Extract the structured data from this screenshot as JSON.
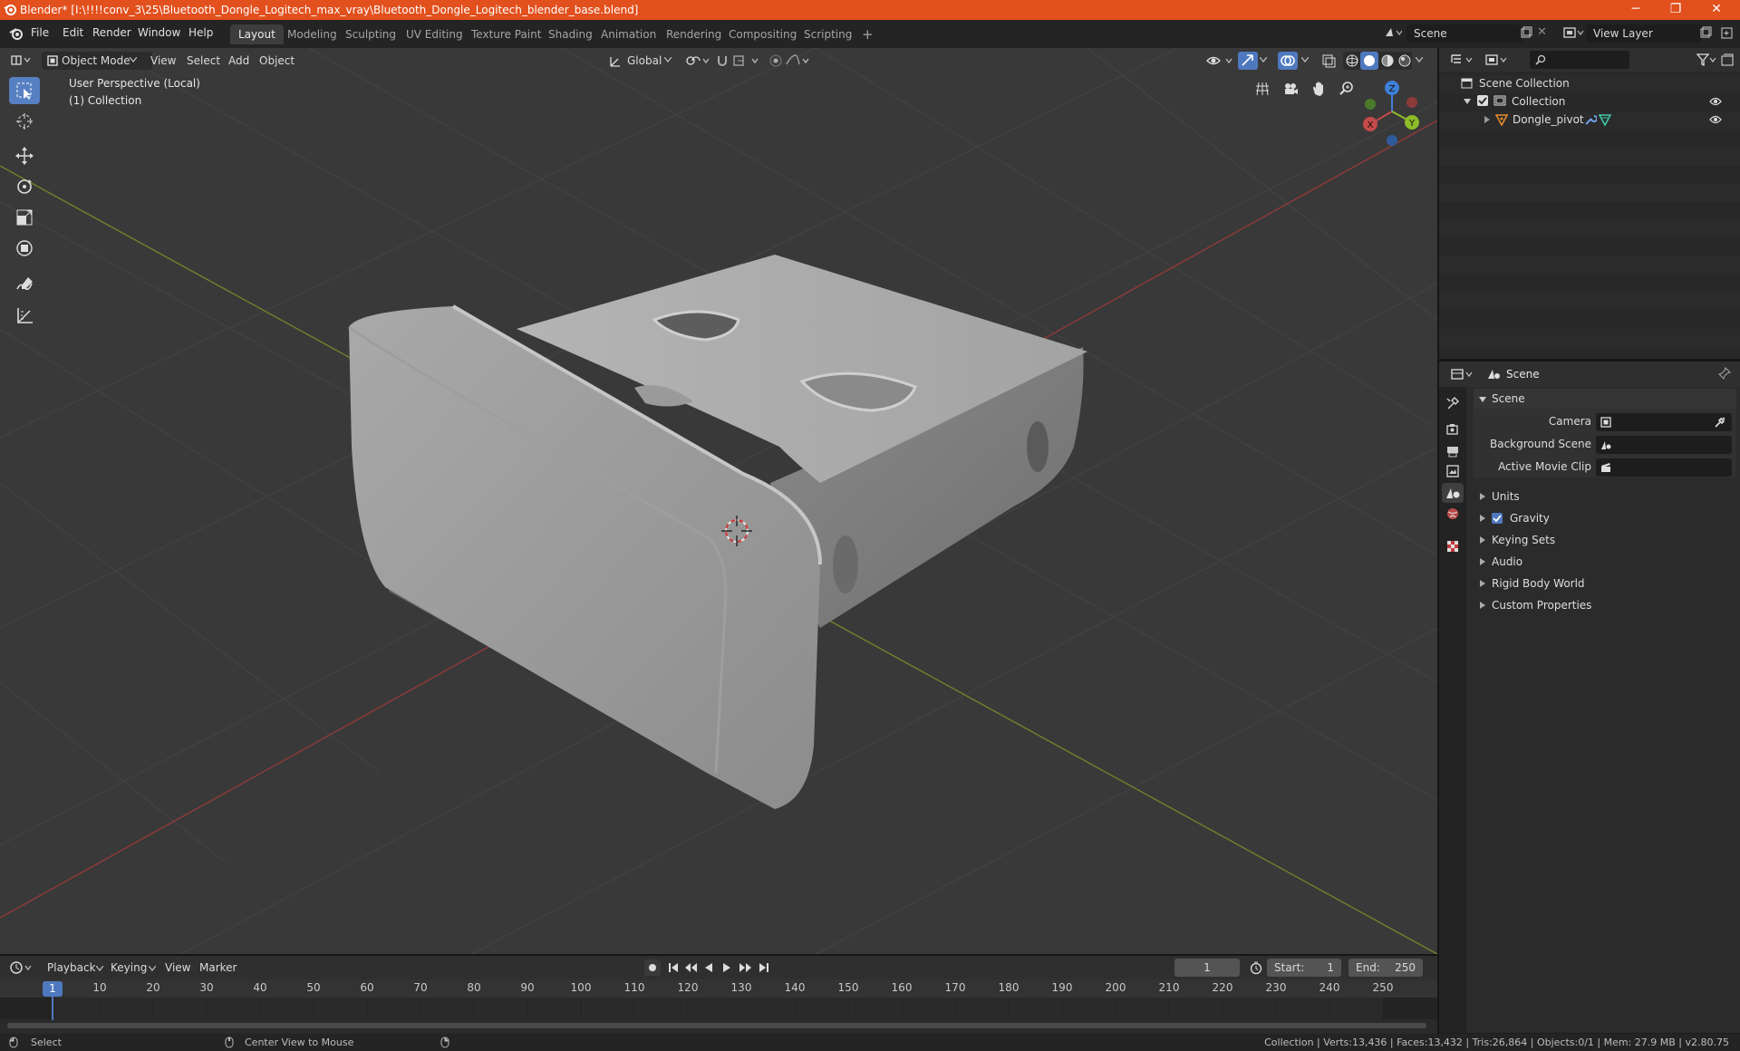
{
  "window": {
    "title": "Blender* [I:\\!!!!conv_3\\25\\Bluetooth_Dongle_Logitech_max_vray\\Bluetooth_Dongle_Logitech_blender_base.blend]",
    "minimize": "─",
    "maximize": "❐",
    "close": "✕"
  },
  "menubar": {
    "items": [
      "File",
      "Edit",
      "Render",
      "Window",
      "Help"
    ],
    "workspaces": [
      "Layout",
      "Modeling",
      "Sculpting",
      "UV Editing",
      "Texture Paint",
      "Shading",
      "Animation",
      "Rendering",
      "Compositing",
      "Scripting"
    ],
    "active_workspace": "Layout",
    "add_tab": "+",
    "scene_name": "Scene",
    "view_layer": "View Layer"
  },
  "viewport": {
    "mode": "Object Mode",
    "menus": [
      "View",
      "Select",
      "Add",
      "Object"
    ],
    "transform_orientation": "Global",
    "overlay_line1": "User Perspective (Local)",
    "overlay_line2": "(1) Collection",
    "gizmo": {
      "x": "X",
      "y": "Y",
      "z": "Z"
    }
  },
  "outliner": {
    "search_placeholder": "",
    "root": "Scene Collection",
    "collection": "Collection",
    "object": "Dongle_pivot"
  },
  "properties": {
    "header": "Scene",
    "panel": "Scene",
    "camera_label": "Camera",
    "background_label": "Background Scene",
    "clip_label": "Active Movie Clip",
    "sections": [
      "Units",
      "Gravity",
      "Keying Sets",
      "Audio",
      "Rigid Body World",
      "Custom Properties"
    ],
    "gravity_checked": true
  },
  "timeline": {
    "menus": [
      "Playback",
      "Keying",
      "View",
      "Marker"
    ],
    "current_frame": "1",
    "start_label": "Start:",
    "start_value": "1",
    "end_label": "End:",
    "end_value": "250",
    "ruler_current": "1",
    "ruler_ticks": [
      "10",
      "20",
      "30",
      "40",
      "50",
      "60",
      "70",
      "80",
      "90",
      "100",
      "110",
      "120",
      "130",
      "140",
      "150",
      "160",
      "170",
      "180",
      "190",
      "200",
      "210",
      "220",
      "230",
      "240",
      "250"
    ]
  },
  "statusbar": {
    "select": "Select",
    "center": "Center View to Mouse",
    "stats": "Collection | Verts:13,436 | Faces:13,432 | Tris:26,864 | Objects:0/1 | Mem: 27.9 MB | v2.80.75"
  },
  "colors": {
    "titlebar": "#e2501d",
    "accent": "#5680c2",
    "x_axis": "#c44a4a",
    "y_axis": "#8dbb2a",
    "z_axis": "#3f7fd7"
  }
}
